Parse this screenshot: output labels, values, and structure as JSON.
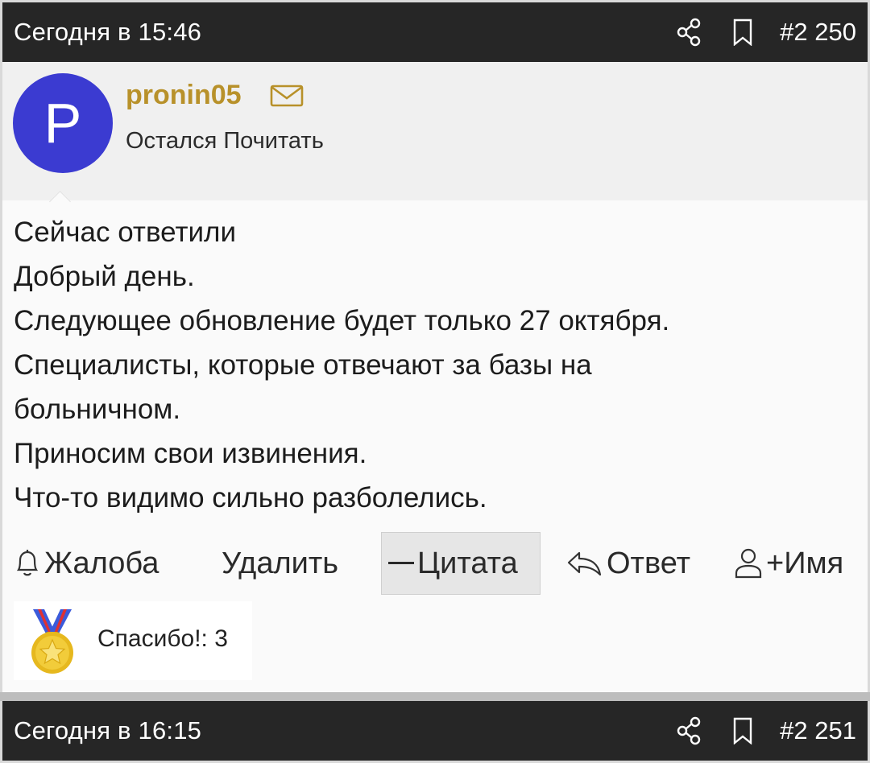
{
  "posts": [
    {
      "time": "Сегодня в 15:46",
      "number": "#2 250",
      "icons": [
        "share-icon",
        "bookmark-icon"
      ]
    },
    {
      "time": "Сегодня в 16:15",
      "number": "#2 251",
      "icons": [
        "share-icon",
        "bookmark-icon"
      ]
    }
  ],
  "author": {
    "avatar_letter": "P",
    "avatar_color": "#3b3bd1",
    "username": "pronin05",
    "username_color": "#b8912a",
    "title": "Остался Почитать",
    "icon": "mail-icon"
  },
  "message": {
    "lines": [
      "Сейчас ответили",
      "Добрый день.",
      "Следующее обновление будет только 27 октября.",
      "Специалисты, которые отвечают за базы на",
      "больничном.",
      "Приносим свои извинения.",
      "Что-то видимо сильно разболелись."
    ]
  },
  "actions": {
    "report": "Жалоба",
    "delete": "Удалить",
    "quote": "Цитата",
    "reply": "Ответ",
    "mention": "+Имя"
  },
  "reaction": {
    "label": "Спасибо!: 3",
    "icon": "medal-icon"
  }
}
